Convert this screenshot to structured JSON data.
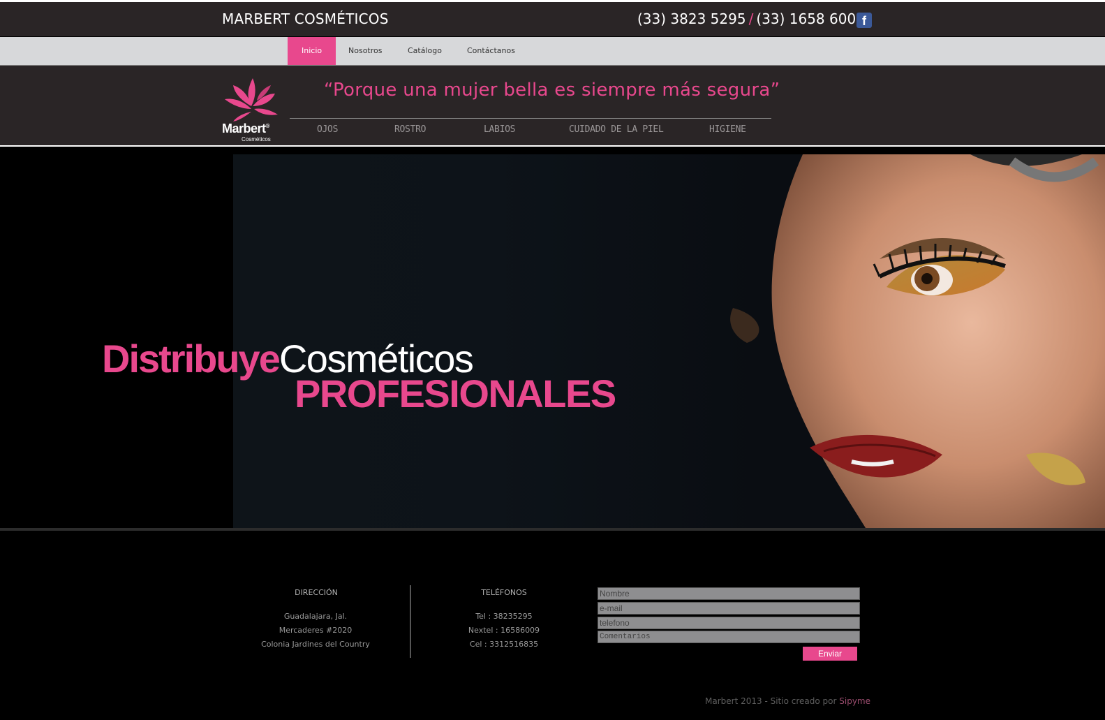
{
  "topbar": {
    "brand": "MARBERT COSMÉTICOS",
    "phone1": "(33) 3823 5295",
    "separator": "/",
    "phone2": "(33) 1658 6009",
    "facebook_glyph": "f",
    "facebook_icon": "facebook-icon"
  },
  "nav": {
    "items": [
      {
        "label": "Inicio",
        "active": true
      },
      {
        "label": "Nosotros",
        "active": false
      },
      {
        "label": "Catálogo",
        "active": false
      },
      {
        "label": "Contáctanos",
        "active": false
      }
    ]
  },
  "header": {
    "logo_text": "Marbert",
    "logo_reg": "®",
    "logo_sub": "Cosméticos",
    "slogan": "“Porque una mujer bella es siempre más segura”",
    "categories": [
      "OJOS",
      "ROSTRO",
      "LABIOS",
      "CUIDADO DE LA PIEL",
      "HIGIENE"
    ]
  },
  "hero": {
    "word1": "Distribuye",
    "word2": "Cosméticos",
    "word3": "PROFESIONALES"
  },
  "footer": {
    "address": {
      "title": "DIRECCIÓN",
      "lines": [
        "Guadalajara, Jal.",
        "Mercaderes #2020",
        "Colonia Jardines del Country"
      ]
    },
    "phones": {
      "title": "TELÉFONOS",
      "lines": [
        "Tel : 38235295",
        "Nextel : 16586009",
        "Cel : 3312516835"
      ]
    },
    "form": {
      "name_placeholder": "Nombre",
      "email_placeholder": "e-mail",
      "phone_placeholder": "telefono",
      "comments_placeholder": "Comentarios",
      "submit_label": "Enviar"
    },
    "copyright": "Marbert 2013 - Sitio creado por",
    "credit": "Sipyme"
  },
  "colors": {
    "accent": "#e8488d",
    "topbar_bg": "#2a2526",
    "nav_bg": "#d7d8da"
  }
}
